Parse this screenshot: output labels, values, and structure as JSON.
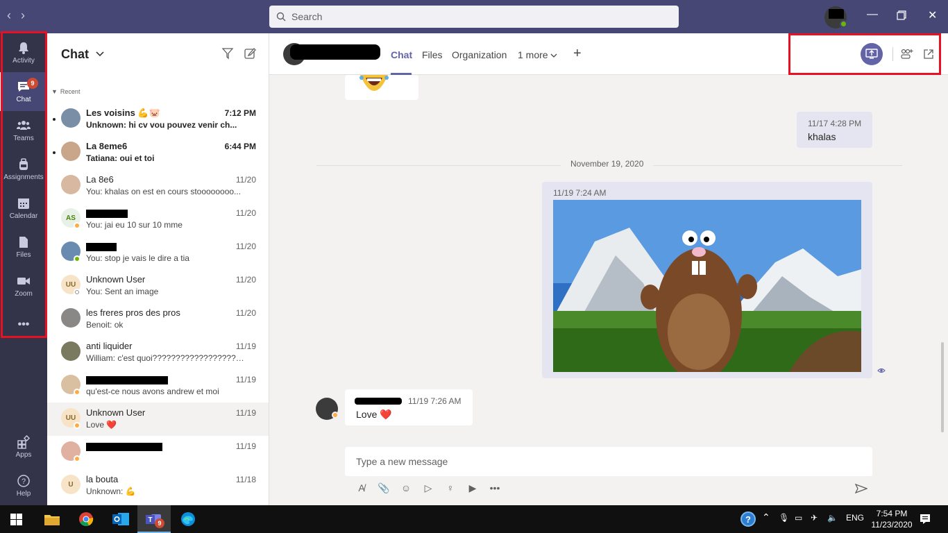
{
  "topbar": {
    "search_placeholder": "Search",
    "back_icon": "chevron-left-icon",
    "forward_icon": "chevron-right-icon"
  },
  "rail": {
    "items": [
      {
        "label": "Activity",
        "icon": "bell-icon"
      },
      {
        "label": "Chat",
        "icon": "chat-icon",
        "badge": "9"
      },
      {
        "label": "Teams",
        "icon": "teams-icon"
      },
      {
        "label": "Assignments",
        "icon": "backpack-icon"
      },
      {
        "label": "Calendar",
        "icon": "calendar-icon"
      },
      {
        "label": "Files",
        "icon": "file-icon"
      },
      {
        "label": "Zoom",
        "icon": "video-icon"
      }
    ],
    "more": "•••",
    "apps_label": "Apps",
    "help_label": "Help",
    "highlight_color": "#e81123"
  },
  "chatlist": {
    "title": "Chat",
    "section": "Recent",
    "rows": [
      {
        "name": "Les voisins 💪🐷",
        "time": "7:12 PM",
        "preview": "Unknown: hi cv vou pouvez venir ch...",
        "avatar_initials": "",
        "avatar_color": "#7a8fa6",
        "status_color": "",
        "unread": true
      },
      {
        "name": "La 8eme6",
        "time": "6:44 PM",
        "preview": "Tatiana: oui et toi",
        "avatar_initials": "",
        "avatar_color": "#c9a58a",
        "status_color": "",
        "unread": true
      },
      {
        "name": "La 8e6",
        "time": "11/20",
        "preview": "You: khalas on est en cours stoooooooo...",
        "avatar_initials": "",
        "avatar_color": "#d8b8a0",
        "status_color": "",
        "unread": false
      },
      {
        "name": "",
        "time": "11/20",
        "preview": "You: jai eu 10 sur 10 mme",
        "avatar_initials": "AS",
        "avatar_color": "#e8f1e8",
        "status_color": "#ffaa44",
        "unread": false,
        "redacted": true
      },
      {
        "name": "",
        "time": "11/20",
        "preview": "You: stop je vais le dire a tia",
        "avatar_initials": "",
        "avatar_color": "#6a8bb0",
        "status_color": "#6bb700",
        "unread": false,
        "redacted": true
      },
      {
        "name": "Unknown User",
        "time": "11/20",
        "preview": "You: Sent an image",
        "avatar_initials": "UU",
        "avatar_color": "#f7e4c8",
        "status_color": "#ffffff",
        "unread": false
      },
      {
        "name": "les freres pros des pros",
        "time": "11/20",
        "preview": "Benoit: ok",
        "avatar_initials": "",
        "avatar_color": "#8a8886",
        "status_color": "",
        "unread": false
      },
      {
        "name": "anti liquider",
        "time": "11/19",
        "preview": "William: c'est quoi?????????????????????...",
        "avatar_initials": "",
        "avatar_color": "#7a7a60",
        "status_color": "",
        "unread": false
      },
      {
        "name": "",
        "time": "11/19",
        "preview": "qu'est-ce nous avons andrew et moi",
        "avatar_initials": "",
        "avatar_color": "#d8c0a0",
        "status_color": "#ffaa44",
        "unread": false,
        "redacted": true
      },
      {
        "name": "Unknown User",
        "time": "11/19",
        "preview": "Love ❤️",
        "avatar_initials": "UU",
        "avatar_color": "#f7e4c8",
        "status_color": "#ffaa44",
        "unread": false,
        "selected": true
      },
      {
        "name": "",
        "time": "11/19",
        "preview": "",
        "avatar_initials": "",
        "avatar_color": "#e0b0a0",
        "status_color": "#ffaa44",
        "unread": false,
        "redacted": true
      },
      {
        "name": "la bouta",
        "time": "11/18",
        "preview": "Unknown: 💪",
        "avatar_initials": "U",
        "avatar_color": "#f7e4c8",
        "status_color": "",
        "unread": false
      }
    ]
  },
  "conversation": {
    "tabs": [
      "Chat",
      "Files",
      "Organization",
      "1 more"
    ],
    "messages": [
      {
        "time": "11/17 4:28 PM",
        "text": "khalas"
      },
      {
        "time": "11/19 7:24 AM",
        "text": ""
      },
      {
        "time": "11/19 7:26 AM",
        "text": "Love ❤️"
      }
    ],
    "date_separator": "November 19, 2020",
    "composer_placeholder": "Type a new message"
  },
  "taskbar": {
    "lang": "ENG",
    "time": "7:54 PM",
    "date": "11/23/2020",
    "teams_badge": "9"
  },
  "colors": {
    "brand": "#6264a7",
    "topbar": "#464775",
    "rail": "#33344a",
    "highlight": "#e81123"
  }
}
